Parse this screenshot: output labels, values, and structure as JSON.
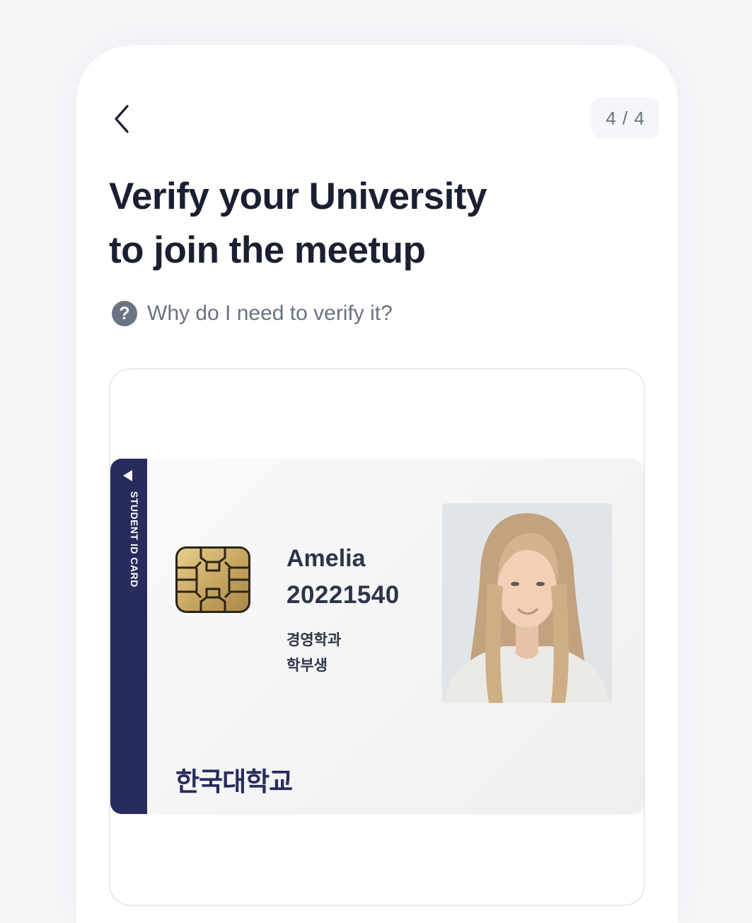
{
  "header": {
    "back_icon": "chevron-left-icon",
    "step_indicator": "4 / 4"
  },
  "title": {
    "line1": "Verify your University",
    "line2": "to join the meetup"
  },
  "help": {
    "icon": "question-circle-icon",
    "text": "Why do I need to verify it?"
  },
  "id_card": {
    "strip_label": "STUDENT ID CARD",
    "name": "Amelia",
    "student_number": "20221540",
    "department": "경영학과",
    "level": "학부생",
    "university": "한국대학교",
    "colors": {
      "strip": "#272c5c",
      "chip": "#c9a862"
    }
  }
}
